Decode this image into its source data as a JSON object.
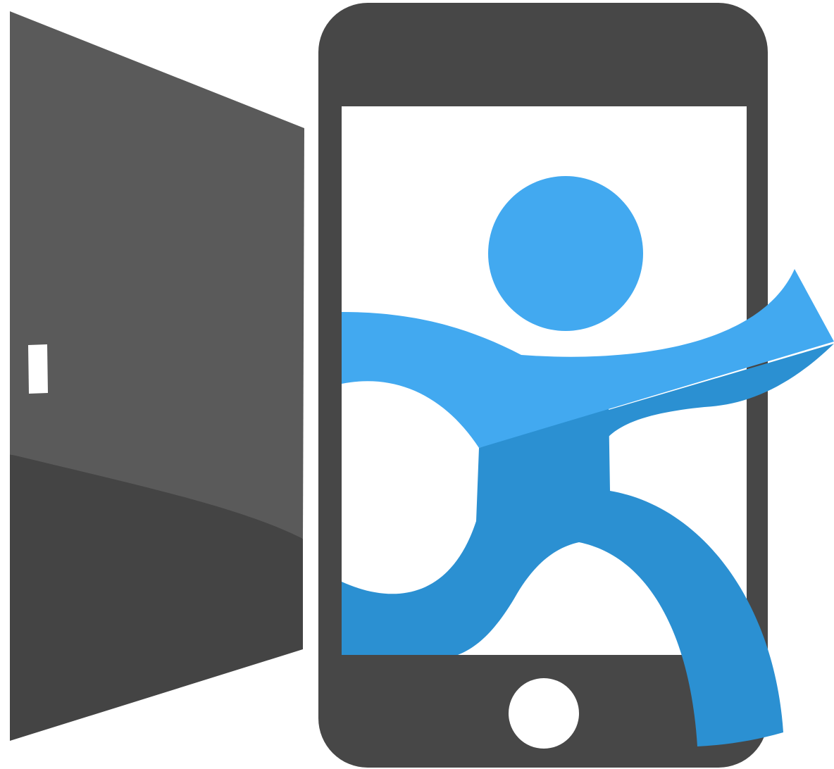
{
  "logo": {
    "name": "door-and-phone-runner-logo",
    "colors": {
      "door_upper": "#5a5a5a",
      "door_lower": "#444444",
      "door_handle": "#ffffff",
      "phone_body": "#474747",
      "screen": "#ffffff",
      "home_button": "#ffffff",
      "figure_light": "#42a9f0",
      "figure_dark": "#2b90d2"
    },
    "icons": [
      "open-door-icon",
      "smartphone-icon",
      "running-person-icon",
      "home-button-icon"
    ]
  }
}
